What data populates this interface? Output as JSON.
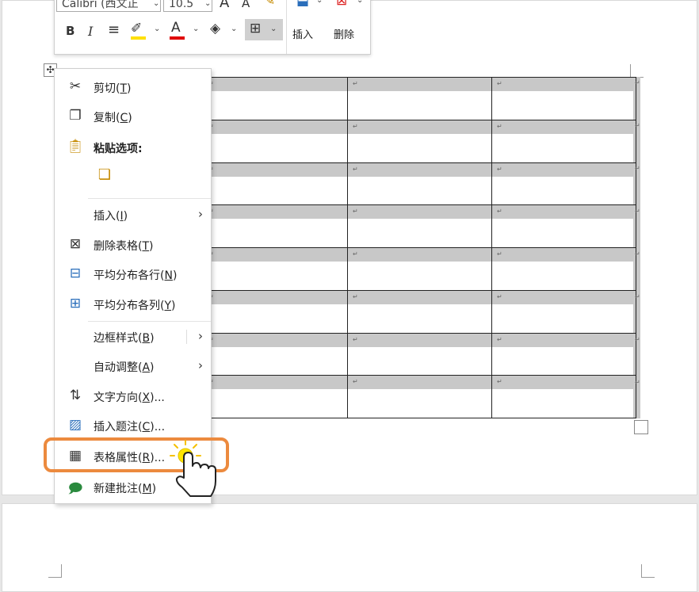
{
  "mini_toolbar": {
    "font_name": "Calibri (西文正",
    "font_size": "10.5",
    "insert_label": "插入",
    "delete_label": "删除",
    "bold": "B",
    "italic": "I",
    "font_grow": "A",
    "font_shrink": "A",
    "font_color_letter": "A"
  },
  "context_menu": {
    "items": [
      {
        "label": "剪切(",
        "key": "T",
        "tail": ")"
      },
      {
        "label": "复制(",
        "key": "C",
        "tail": ")"
      },
      {
        "label": "粘贴选项:"
      },
      {
        "label": "插入(",
        "key": "I",
        "tail": ")"
      },
      {
        "label": "删除表格(",
        "key": "T",
        "tail": ")"
      },
      {
        "label": "平均分布各行(",
        "key": "N",
        "tail": ")"
      },
      {
        "label": "平均分布各列(",
        "key": "Y",
        "tail": ")"
      },
      {
        "label": "边框样式(",
        "key": "B",
        "tail": ")"
      },
      {
        "label": "自动调整(",
        "key": "A",
        "tail": ")"
      },
      {
        "label": "文字方向(",
        "key": "X",
        "tail": ")..."
      },
      {
        "label": "插入题注(",
        "key": "C",
        "tail": ")..."
      },
      {
        "label": "表格属性(",
        "key": "R",
        "tail": ")..."
      },
      {
        "label": "新建批注(",
        "key": "M",
        "tail": ")"
      }
    ]
  },
  "table": {
    "rows": 8,
    "cols": 3,
    "cell_mark": "↵"
  },
  "colors": {
    "highlight": "#ec8a3e",
    "font_color_bar": "#e00000",
    "highlight_bar": "#ffe000"
  }
}
